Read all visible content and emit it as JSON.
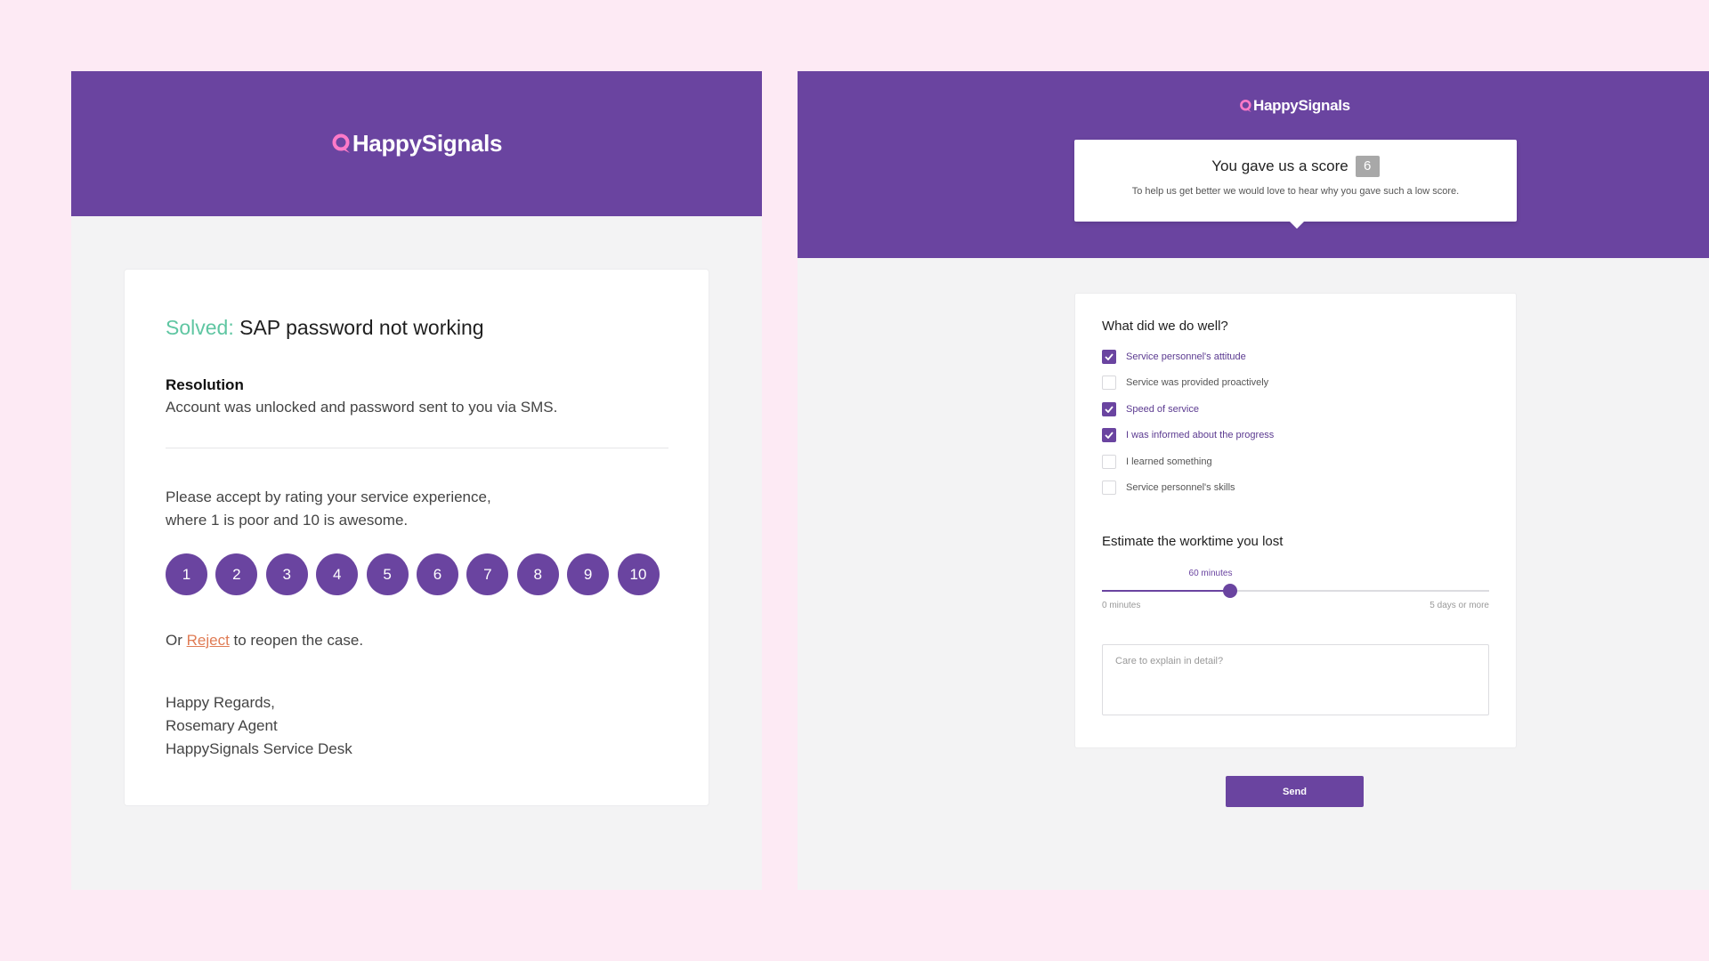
{
  "brand": {
    "name": "HappySignals",
    "colors": {
      "primary": "#6a44a0",
      "accent_pink": "#ff7ac8",
      "solved_green": "#5fc6a2",
      "reject_orange": "#e07c55",
      "background": "#fdeaf4"
    },
    "icon": "speech-bubble-logo-icon"
  },
  "email": {
    "solved_label": "Solved:",
    "subject": " SAP password not working",
    "resolution_title": "Resolution",
    "resolution_text": "Account was unlocked and password sent to you via SMS.",
    "prompt_line1": "Please accept by rating your service experience,",
    "prompt_line2": "where 1 is poor and 10 is awesome.",
    "ratings": [
      "1",
      "2",
      "3",
      "4",
      "5",
      "6",
      "7",
      "8",
      "9",
      "10"
    ],
    "reject_prefix": "Or ",
    "reject_link": "Reject",
    "reject_suffix": " to reopen the case.",
    "signoff": [
      "Happy Regards,",
      "Rosemary Agent",
      "HappySignals Service Desk"
    ]
  },
  "survey": {
    "score_title": "You gave us a score",
    "score": "6",
    "score_subtitle": "To help us get better we would love to hear why you gave such a low score.",
    "question": "What did we do well?",
    "options": [
      {
        "label": "Service personnel's attitude",
        "checked": true
      },
      {
        "label": "Service was provided proactively",
        "checked": false
      },
      {
        "label": "Speed of service",
        "checked": true
      },
      {
        "label": "I was informed about the progress",
        "checked": true
      },
      {
        "label": "I learned something",
        "checked": false
      },
      {
        "label": "Service personnel's skills",
        "checked": false
      }
    ],
    "worktime_title": "Estimate the worktime you lost",
    "slider_value_label": "60 minutes",
    "slider_fraction": 0.33,
    "slider_min_label": "0 minutes",
    "slider_max_label": "5 days or more",
    "explain_placeholder": "Care to explain in detail?",
    "send_label": "Send"
  }
}
